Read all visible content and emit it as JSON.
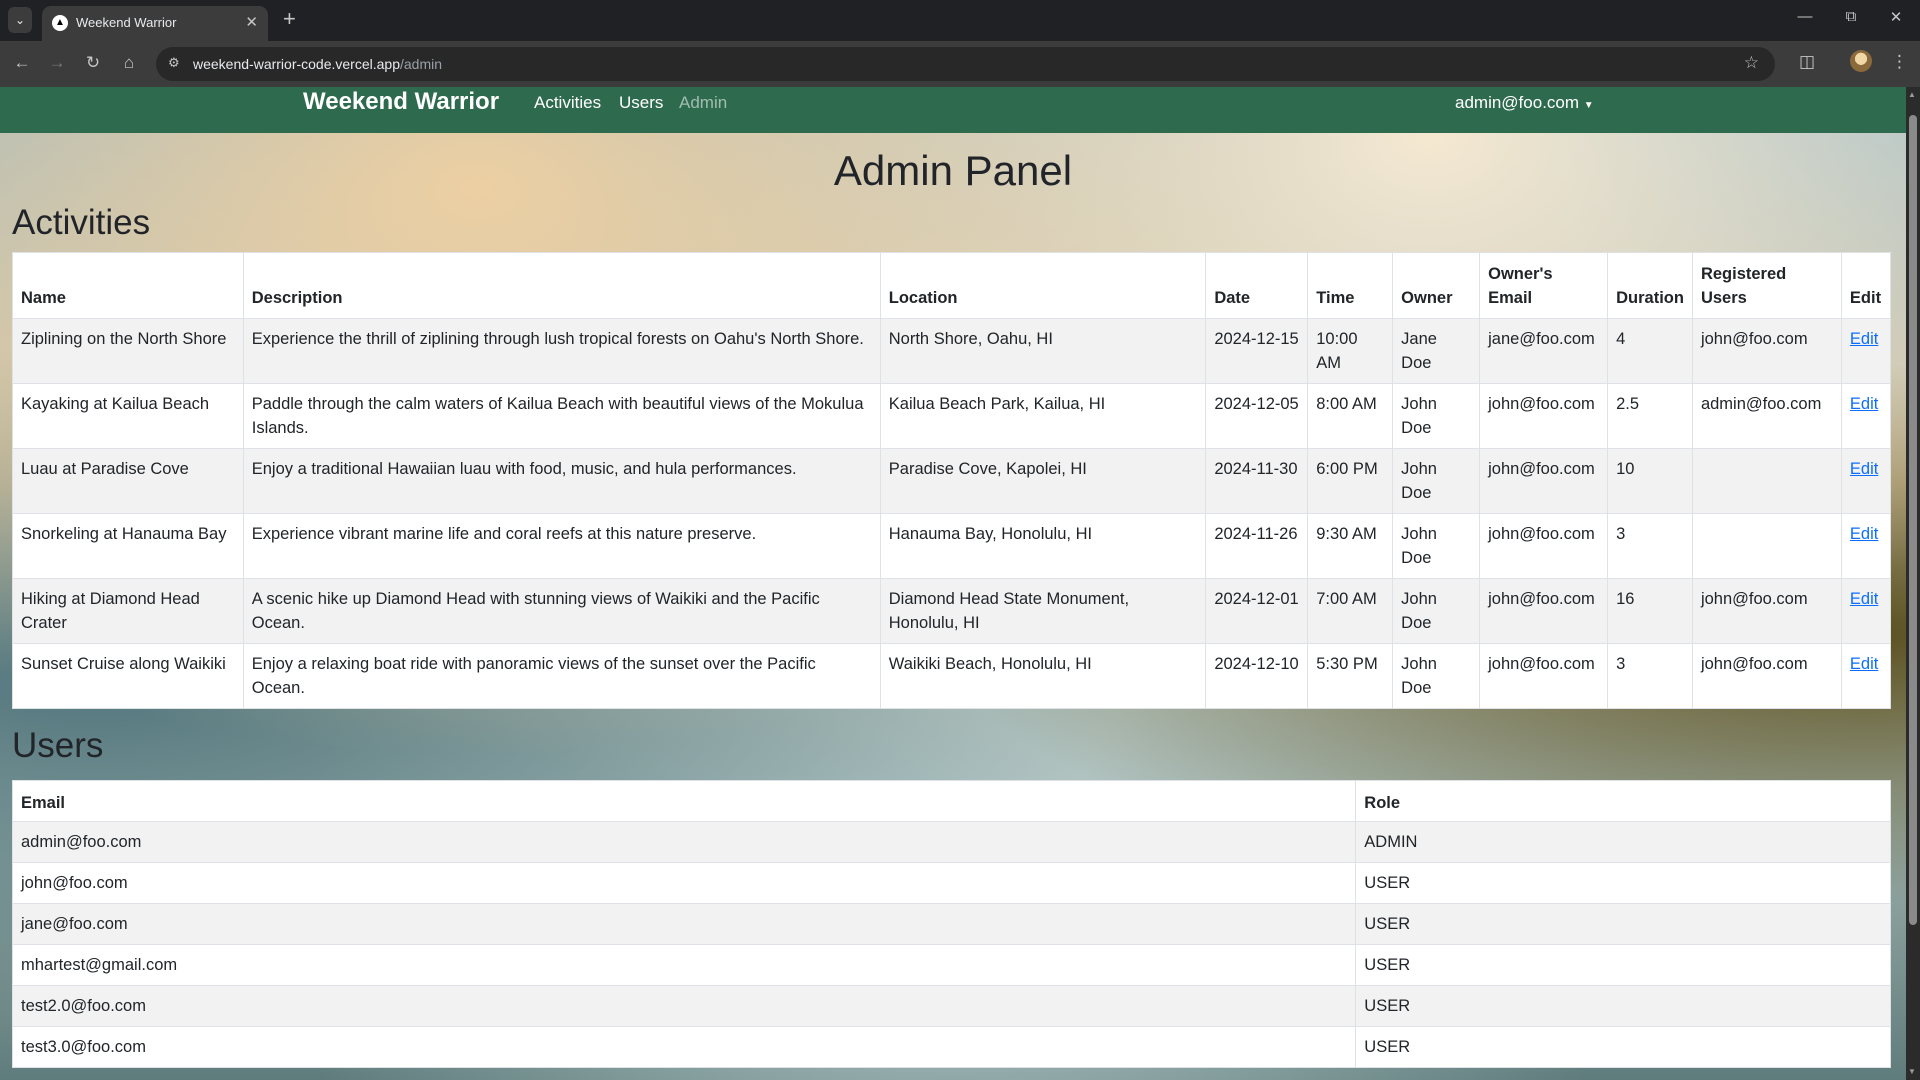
{
  "browser": {
    "tab_title": "Weekend Warrior",
    "url_host": "weekend-warrior-code.vercel.app",
    "url_path": "/admin"
  },
  "navbar": {
    "brand": "Weekend Warrior",
    "links": [
      "Activities",
      "Users",
      "Admin"
    ],
    "user": "admin@foo.com"
  },
  "page": {
    "title": "Admin Panel",
    "activities_heading": "Activities",
    "users_heading": "Users"
  },
  "activities": {
    "headers": [
      "Name",
      "Description",
      "Location",
      "Date",
      "Time",
      "Owner",
      "Owner's Email",
      "Duration",
      "Registered Users",
      "Edit"
    ],
    "rows": [
      [
        "Ziplining on the North Shore",
        "Experience the thrill of ziplining through lush tropical forests on Oahu's North Shore.",
        "North Shore, Oahu, HI",
        "2024-12-15",
        "10:00 AM",
        "Jane Doe",
        "jane@foo.com",
        "4",
        "john@foo.com",
        "Edit"
      ],
      [
        "Kayaking at Kailua Beach",
        "Paddle through the calm waters of Kailua Beach with beautiful views of the Mokulua Islands.",
        "Kailua Beach Park, Kailua, HI",
        "2024-12-05",
        "8:00 AM",
        "John Doe",
        "john@foo.com",
        "2.5",
        "admin@foo.com",
        "Edit"
      ],
      [
        "Luau at Paradise Cove",
        "Enjoy a traditional Hawaiian luau with food, music, and hula performances.",
        "Paradise Cove, Kapolei, HI",
        "2024-11-30",
        "6:00 PM",
        "John Doe",
        "john@foo.com",
        "10",
        "",
        "Edit"
      ],
      [
        "Snorkeling at Hanauma Bay",
        "Experience vibrant marine life and coral reefs at this nature preserve.",
        "Hanauma Bay, Honolulu, HI",
        "2024-11-26",
        "9:30 AM",
        "John Doe",
        "john@foo.com",
        "3",
        "",
        "Edit"
      ],
      [
        "Hiking at Diamond Head Crater",
        "A scenic hike up Diamond Head with stunning views of Waikiki and the Pacific Ocean.",
        "Diamond Head State Monument, Honolulu, HI",
        "2024-12-01",
        "7:00 AM",
        "John Doe",
        "john@foo.com",
        "16",
        "john@foo.com",
        "Edit"
      ],
      [
        "Sunset Cruise along Waikiki",
        "Enjoy a relaxing boat ride with panoramic views of the sunset over the Pacific Ocean.",
        "Waikiki Beach, Honolulu, HI",
        "2024-12-10",
        "5:30 PM",
        "John Doe",
        "john@foo.com",
        "3",
        "john@foo.com",
        "Edit"
      ]
    ]
  },
  "users": {
    "headers": [
      "Email",
      "Role"
    ],
    "rows": [
      [
        "admin@foo.com",
        "ADMIN"
      ],
      [
        "john@foo.com",
        "USER"
      ],
      [
        "jane@foo.com",
        "USER"
      ],
      [
        "mhartest@gmail.com",
        "USER"
      ],
      [
        "test2.0@foo.com",
        "USER"
      ],
      [
        "test3.0@foo.com",
        "USER"
      ]
    ]
  },
  "colors": {
    "navbar": "#2e6b4e",
    "link": "#0d6efd"
  },
  "icons": [
    "tab-search-icon",
    "close-icon",
    "plus-icon",
    "back-arrow-icon",
    "forward-arrow-icon",
    "reload-icon",
    "home-icon",
    "site-settings-icon",
    "star-icon",
    "extensions-icon",
    "profile-avatar-icon",
    "more-icon",
    "minimize-icon",
    "restore-icon",
    "window-close-icon",
    "caret-down-icon"
  ]
}
